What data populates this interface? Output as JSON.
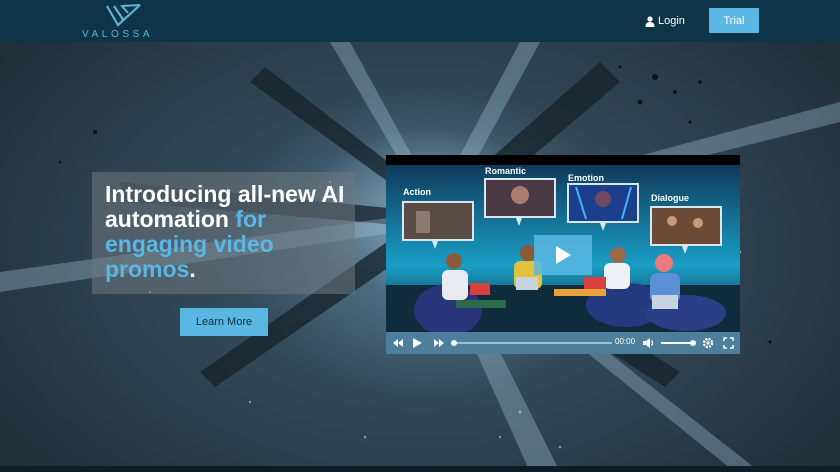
{
  "header": {
    "logo_text": "VALOSSA",
    "login_label": "Login",
    "trial_label": "Trial"
  },
  "hero": {
    "headline_white": "Introducing all-new AI automation",
    "headline_accent": "for engaging video promos",
    "headline_end": ".",
    "cta_label": "Learn More"
  },
  "video": {
    "labels": {
      "action": "Action",
      "romantic": "Romantic",
      "emotion": "Emotion",
      "dialogue": "Dialogue"
    },
    "time": "00:00",
    "progress": 0,
    "volume": 1.0
  },
  "icons": [
    "valossa-logo-icon",
    "user-icon",
    "rewind-icon",
    "play-icon",
    "fast-forward-icon",
    "volume-icon",
    "gear-icon",
    "fullscreen-icon"
  ],
  "colors": {
    "header_bg": "#0e3447",
    "accent": "#5ab7e4",
    "control_bar": "#4d7f9c"
  }
}
